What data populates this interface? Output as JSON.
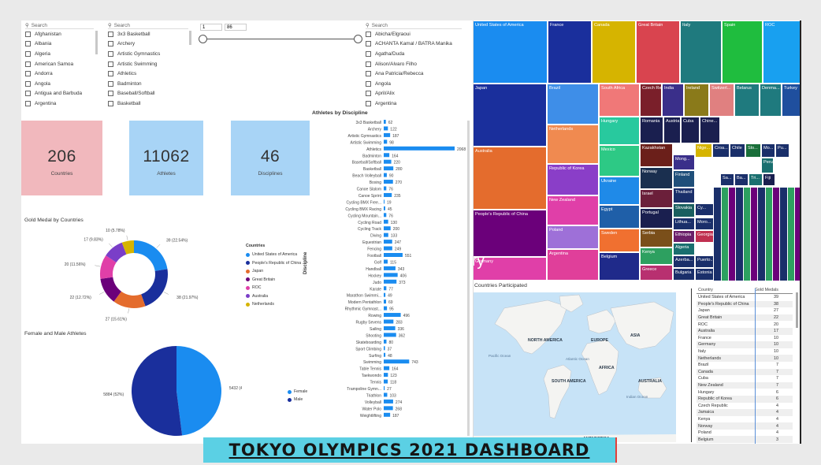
{
  "slicers": {
    "countries": {
      "placeholder": "Search",
      "items": [
        "Afghanistan",
        "Albania",
        "Algeria",
        "American Samoa",
        "Andorra",
        "Angola",
        "Antigua and Barbuda",
        "Argentina"
      ]
    },
    "disciplines": {
      "placeholder": "Search",
      "items": [
        "3x3 Basketball",
        "Archery",
        "Artistic Gymnastics",
        "Artistic Swimming",
        "Athletics",
        "Badminton",
        "Baseball/Softball",
        "Basketball"
      ]
    },
    "range": {
      "min": "1",
      "max": "86"
    },
    "athletes": {
      "placeholder": "Search",
      "items": [
        "Abicha/Elgraoui",
        "ACHANTA Kamal / BATRA Manika",
        "Agatha/Duda",
        "Alison/Alvaro Filho",
        "Ana Patricia/Rebecca",
        "Angola",
        "April/Alix",
        "Argentina"
      ]
    }
  },
  "kpis": [
    {
      "value": "206",
      "label": "Countries",
      "color": "#f1b8bd"
    },
    {
      "value": "11062",
      "label": "Athletes",
      "color": "#a8d4f6"
    },
    {
      "value": "46",
      "label": "Disciplines",
      "color": "#a8d4f6"
    }
  ],
  "gold_title": "Gold Medal by Countries",
  "gender_title": "Female and Male Athletes",
  "athletes_title": "Athletes by Discipline",
  "athletes_axis": "Discipline",
  "countries_participated": "Countries Participated",
  "stray_text": "ry",
  "stray_text2": "y",
  "legend": {
    "title": "Countries",
    "items": [
      {
        "name": "United States of America",
        "color": "#1a8cf0"
      },
      {
        "name": "People's Republic of China",
        "color": "#1a2f9c"
      },
      {
        "name": "Japan",
        "color": "#e46c2d"
      },
      {
        "name": "Great Britain",
        "color": "#6b007a"
      },
      {
        "name": "ROC",
        "color": "#e03fa8"
      },
      {
        "name": "Australia",
        "color": "#7a3ec8"
      },
      {
        "name": "Netherlands",
        "color": "#d6b400"
      }
    ]
  },
  "gender_legend": [
    {
      "name": "Female",
      "color": "#1a8cf0"
    },
    {
      "name": "Male",
      "color": "#1a2f9c"
    }
  ],
  "map_labels": [
    {
      "t": "NORTH AMERICA"
    },
    {
      "t": "EUROPE"
    },
    {
      "t": "ASIA"
    },
    {
      "t": "AFRICA"
    },
    {
      "t": "SOUTH AMERICA"
    },
    {
      "t": "AUSTRALIA"
    },
    {
      "t": "ANTARCTICA"
    },
    {
      "t": "Pacific Ocean"
    },
    {
      "t": "Atlantic Ocean"
    },
    {
      "t": "Indian Ocean"
    }
  ],
  "table": {
    "headers": [
      "Country",
      "Gold Medals"
    ],
    "rows": [
      [
        "United States of America",
        "39"
      ],
      [
        "People's Republic of China",
        "38"
      ],
      [
        "Japan",
        "27"
      ],
      [
        "Great Britain",
        "22"
      ],
      [
        "ROC",
        "20"
      ],
      [
        "Australia",
        "17"
      ],
      [
        "France",
        "10"
      ],
      [
        "Germany",
        "10"
      ],
      [
        "Italy",
        "10"
      ],
      [
        "Netherlands",
        "10"
      ],
      [
        "Brazil",
        "7"
      ],
      [
        "Canada",
        "7"
      ],
      [
        "Cuba",
        "7"
      ],
      [
        "New Zealand",
        "7"
      ],
      [
        "Hungary",
        "6"
      ],
      [
        "Republic of Korea",
        "6"
      ],
      [
        "Czech Republic",
        "4"
      ],
      [
        "Jamaica",
        "4"
      ],
      [
        "Kenya",
        "4"
      ],
      [
        "Norway",
        "4"
      ],
      [
        "Poland",
        "4"
      ],
      [
        "Belgium",
        "3"
      ]
    ]
  },
  "title": "TOKYO OLYMPICS 2021 DASHBOARD",
  "chart_data": [
    {
      "type": "pie",
      "variant": "donut",
      "title": "Gold Medal by Countries",
      "categories": [
        "United States of America",
        "People's Republic of China",
        "Japan",
        "Great Britain",
        "ROC",
        "Australia",
        "Netherlands"
      ],
      "values": [
        39,
        38,
        27,
        22,
        20,
        17,
        10
      ],
      "labels": [
        "39 (22.54%)",
        "38 (21.97%)",
        "27 (15.61%)",
        "22 (12.72%)",
        "20 (11.56%)",
        "17 (9.83%)",
        "10 (5.78%)"
      ],
      "colors": [
        "#1a8cf0",
        "#1a2f9c",
        "#e46c2d",
        "#6b007a",
        "#e03fa8",
        "#7a3ec8",
        "#d6b400"
      ]
    },
    {
      "type": "pie",
      "title": "Female and Male Athletes",
      "categories": [
        "Female",
        "Male"
      ],
      "values": [
        5432,
        5884
      ],
      "labels": [
        "5432 (48%)",
        "5884 (52%)"
      ],
      "colors": [
        "#1a8cf0",
        "#1a2f9c"
      ]
    },
    {
      "type": "bar",
      "orientation": "horizontal",
      "title": "Athletes by Discipline",
      "ylabel": "Discipline",
      "xlim": [
        0,
        2068
      ],
      "categories": [
        "3x3 Basketball",
        "Archery",
        "Artistic Gymnastics",
        "Artistic Swimming",
        "Athletics",
        "Badminton",
        "Baseball/Softball",
        "Basketball",
        "Beach Volleyball",
        "Boxing",
        "Canoe Slalom",
        "Canoe Sprint",
        "Cycling BMX Free...",
        "Cycling BMX Racing",
        "Cycling Mountain...",
        "Cycling Road",
        "Cycling Track",
        "Diving",
        "Equestrian",
        "Fencing",
        "Football",
        "Golf",
        "Handball",
        "Hockey",
        "Judo",
        "Karate",
        "Marathon Swimmi...",
        "Modern Pentathlon",
        "Rhythmic Gymnast...",
        "Rowing",
        "Rugby Sevens",
        "Sailing",
        "Shooting",
        "Skateboarding",
        "Sport Climbing",
        "Surfing",
        "Swimming",
        "Table Tennis",
        "Taekwondo",
        "Tennis",
        "Trampoline Gymn...",
        "Triathlon",
        "Volleyball",
        "Water Polo",
        "Weightlifting"
      ],
      "values": [
        62,
        122,
        187,
        98,
        2068,
        164,
        220,
        280,
        90,
        270,
        76,
        235,
        19,
        45,
        76,
        130,
        200,
        133,
        247,
        249,
        551,
        115,
        343,
        406,
        373,
        77,
        49,
        69,
        95,
        496,
        283,
        336,
        362,
        80,
        37,
        48,
        743,
        164,
        123,
        118,
        27,
        103,
        274,
        268,
        187
      ],
      "labels": [
        "62",
        "122",
        "187",
        "98",
        "2068",
        "164",
        "220",
        "280",
        "90",
        "270",
        "76",
        "235",
        "19",
        "45",
        "76",
        "130",
        "200",
        "133",
        "247",
        "249",
        "551",
        "115",
        "343",
        "406",
        "373",
        "77",
        "49",
        "69",
        "95",
        "496",
        "283",
        "336",
        "362",
        "80",
        "37",
        "48",
        "743",
        "164",
        "123",
        "118",
        "27",
        "103",
        "274",
        "268",
        "187"
      ],
      "color": "#1a8cf0"
    },
    {
      "type": "heatmap",
      "variant": "treemap",
      "categories": [
        "United States of America",
        "France",
        "Canada",
        "Great Britain",
        "Italy",
        "Spain",
        "ROC",
        "Japan",
        "Brazil",
        "South Africa",
        "Czech Re...",
        "India",
        "Ireland",
        "Switzerl...",
        "Belarus",
        "Denma...",
        "Turkey",
        "Hungary",
        "Romania",
        "Austria",
        "Cuba",
        "Chine...",
        "Netherlands",
        "Mexico",
        "Kazakhstan",
        "Ukraine",
        "Norway",
        "Australia",
        "Republic of Korea",
        "Israel",
        "New Zealand",
        "Egypt",
        "Portugal",
        "Serbia",
        "Sweden",
        "Kenya",
        "Belgium",
        "Greece",
        "People's Republic of China",
        "Poland",
        "Argentina",
        "Germany",
        "Thailand",
        "Slovakia",
        "Lithua...",
        "Ethiopia",
        "Georgia",
        "Algeria",
        "Azerba...",
        "Puerto...",
        "Bulgaria",
        "Estonia",
        "Finland",
        "Nige...",
        "Croa...",
        "Chile",
        "Slo...",
        "Mo...",
        "Pu...",
        "Peru",
        "Sa...",
        "Ba...",
        "Tri...",
        "Fiji",
        "Mong...",
        "Cy...",
        "Moro..."
      ],
      "colors": [
        "#1a8cf0",
        "#1a2f9c",
        "#d6b400",
        "#d9444f",
        "#1f7a7e",
        "#1fbd3e",
        "#18a0f0",
        "#1a2f9c",
        "#3e8ee8",
        "#f07878",
        "#7a1f2a",
        "#3a2f8a",
        "#8a7a1a",
        "#e08080",
        "#1f7a7e",
        "#1f7a7e",
        "#1f4f9e",
        "#28c99e",
        "#1a1f4f",
        "#1a1f4f",
        "#1a1f4f",
        "#1a1f4f",
        "#f08a50",
        "#2dc985",
        "#6b1f1a",
        "#1f8ae8",
        "#1a2f4f",
        "#e46c2d",
        "#8a3ec8",
        "#6b1f3a",
        "#e03fa8",
        "#1f5fa8",
        "#1a1f4f",
        "#7a4f1a",
        "#f07030",
        "#2da060",
        "#1f2a8a",
        "#b83070",
        "#6b007a",
        "#9e70d8",
        "#e03f9a",
        "#e03fa8",
        "#1a2f6a",
        "#1a5f5f",
        "#1a2f6a",
        "#6b1f6a",
        "#c03050",
        "#1a6f6f",
        "#1a2f6a",
        "#1a2f6a",
        "#1a2f6a",
        "#1a2f6a",
        "#1f4f7a",
        "#d6b400",
        "#1a2f6a",
        "#1a2f6a",
        "#1a6f3a",
        "#1a2f6a",
        "#1a2f6a",
        "#1a6f6f",
        "#1a2f6a",
        "#1a2f6a",
        "#1a6f6f",
        "#1a1f4f",
        "#3a2f8a",
        "#1a2f6a",
        "#1a2f6a"
      ]
    }
  ]
}
